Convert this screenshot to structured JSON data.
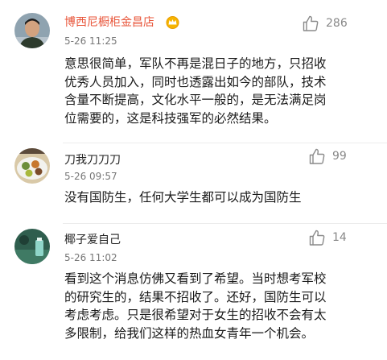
{
  "comments": [
    {
      "username": "博西尼橱柜金昌店",
      "timestamp": "5-26 11:25",
      "likes": "286",
      "content_lines": [
        "意思很简单，军队不再是混日子的地方，只招收",
        "优秀人员加入，同时也透露出如今的部队，技术",
        "含量不断提高，文化水平一般的，是无法满足岗",
        "位需要的，这是科技强军的必然结果。"
      ]
    },
    {
      "username": "刀我刀刀刀",
      "timestamp": "5-26 09:57",
      "likes": "99",
      "content_lines": [
        "没有国防生，任何大学生都可以成为国防生"
      ]
    },
    {
      "username": "椰子爱自己",
      "timestamp": "5-26 11:02",
      "likes": "14",
      "content_lines": [
        "看到这个消息仿佛又看到了希望。当时想考军校",
        "的研究生的，结果不招收了。还好，国防生可以",
        "考虑考虑。只是很希望对于女生的招收不会有太",
        "多限制，给我们这样的热血女青年一个机会。"
      ]
    }
  ],
  "colors": {
    "vip_username": "#e8553a",
    "username": "#222222",
    "timestamp": "#777777",
    "like_count": "#888888",
    "content": "#1a1a1a"
  },
  "icons": {
    "vip_badge": "vip-crown-icon",
    "like": "thumbs-up-icon"
  }
}
